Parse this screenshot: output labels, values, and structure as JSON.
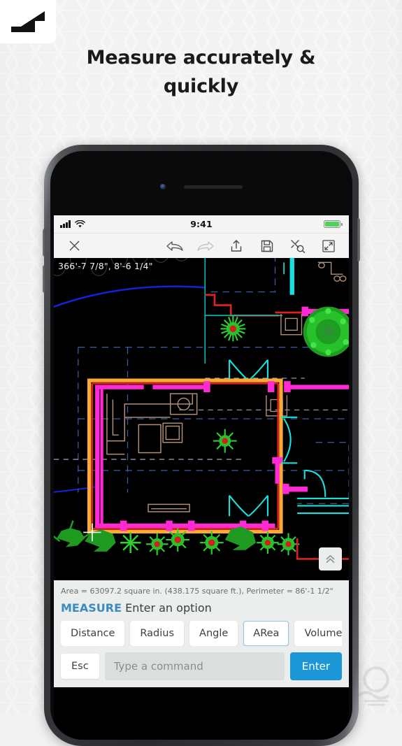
{
  "brand": {
    "logo_icon": "autodesk-logo-icon"
  },
  "headline": {
    "text": "Measure accurately & quickly"
  },
  "phone": {
    "status_bar": {
      "signal_icon": "cellular-signal-icon",
      "wifi_icon": "wifi-icon",
      "time": "9:41",
      "battery_icon": "battery-full-icon"
    },
    "toolbar": {
      "close_icon": "close-icon",
      "undo_icon": "undo-icon",
      "redo_icon": "redo-icon",
      "share_icon": "share-upload-icon",
      "save_icon": "save-floppy-icon",
      "zoom_extents_icon": "zoom-extents-icon",
      "fullscreen_icon": "fullscreen-expand-icon"
    },
    "canvas": {
      "coordinates": "366'-7 7/8\",  8'-6 1/4\"",
      "collapse_icon": "chevron-double-up-icon"
    },
    "command_panel": {
      "area_readout": "Area = 63097.2 square in. (438.175 square ft.), Perimeter = 86'-1 1/2\"",
      "prompt_command": "MEASURE",
      "prompt_text": " Enter an option",
      "options": [
        {
          "label": "Distance",
          "selected": false
        },
        {
          "label": "Radius",
          "selected": false
        },
        {
          "label": "Angle",
          "selected": false
        },
        {
          "label": "ARea",
          "selected": true
        },
        {
          "label": "Volume",
          "selected": false
        }
      ],
      "esc_label": "Esc",
      "input_placeholder": "Type a command",
      "input_value": "",
      "enter_label": "Enter"
    }
  },
  "colors": {
    "accent_blue": "#1b96d6",
    "prompt_blue": "#3a8cc0",
    "selected_border": "#8fc6e6",
    "cad_highlight_orange": "#ffa832",
    "cad_wall_magenta": "#ff2ad4",
    "cad_door_cyan": "#17e0e0",
    "cad_plant_green": "#29d92d",
    "cad_line_red": "#e02020",
    "cad_furniture_tan": "#b08f78",
    "cad_grid_blue": "#3c5f9e",
    "battery_green": "#4cd358"
  }
}
